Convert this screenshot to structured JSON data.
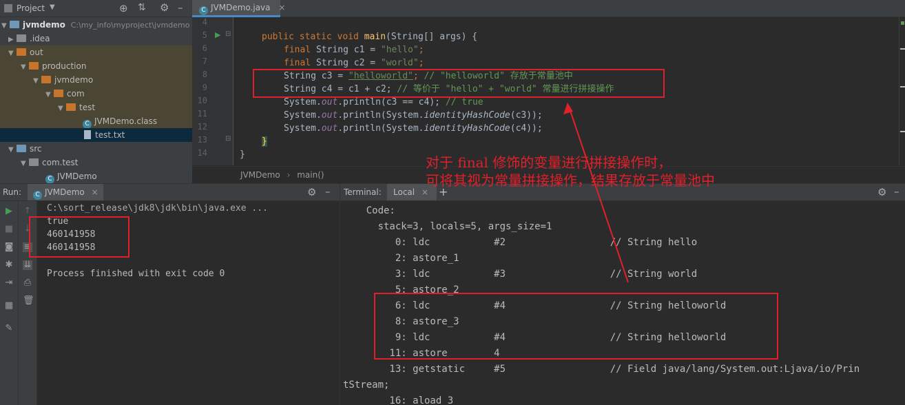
{
  "project_panel": {
    "title": "Project",
    "tree": [
      {
        "label": "jvmdemo",
        "path": "C:\\my_info\\myproject\\jvmdemo",
        "level": 0,
        "expanded": true,
        "icon": "module-folder-icon"
      },
      {
        "label": ".idea",
        "level": 1,
        "expanded": false,
        "icon": "folder-icon"
      },
      {
        "label": "out",
        "level": 1,
        "expanded": true,
        "icon": "folder-icon"
      },
      {
        "label": "production",
        "level": 2,
        "expanded": true,
        "icon": "folder-icon"
      },
      {
        "label": "jvmdemo",
        "level": 3,
        "expanded": true,
        "icon": "folder-icon"
      },
      {
        "label": "com",
        "level": 4,
        "expanded": true,
        "icon": "folder-icon"
      },
      {
        "label": "test",
        "level": 5,
        "expanded": true,
        "icon": "folder-icon"
      },
      {
        "label": "JVMDemo.class",
        "level": 6,
        "icon": "class-file-icon"
      },
      {
        "label": "test.txt",
        "level": 6,
        "icon": "text-file-icon"
      },
      {
        "label": "src",
        "level": 1,
        "expanded": true,
        "icon": "source-folder-icon"
      },
      {
        "label": "com.test",
        "level": 2,
        "expanded": true,
        "icon": "package-icon"
      },
      {
        "label": "JVMDemo",
        "level": 3,
        "icon": "java-class-icon"
      }
    ]
  },
  "editor": {
    "tab_label": "JVMDemo.java",
    "line_numbers": [
      "4",
      "5",
      "6",
      "7",
      "8",
      "9",
      "10",
      "11",
      "12",
      "13",
      "14"
    ],
    "code": {
      "l5_a": "public static void ",
      "l5_fn": "main",
      "l5_b": "(String[] args) {",
      "l6_kw": "final ",
      "l6_a": "String c1 = ",
      "l6_str": "\"hello\"",
      "l6_end": ";",
      "l7_kw": "final ",
      "l7_a": "String c2 = ",
      "l7_str": "\"world\"",
      "l7_end": ";",
      "l8_a": "String c3 = ",
      "l8_str": "\"helloworld\"",
      "l8_end": "; ",
      "l8_cm": "// \"helloworld\" 存放于常量池中",
      "l9_a": "String c4 = c1 + c2; ",
      "l9_cm": "// 等价于 \"hello\" + \"world\" 常量进行拼接操作",
      "l10_a": "System.",
      "l10_out": "out",
      "l10_b": ".println(c3 == c4); ",
      "l10_cm": "// true",
      "l11_a": "System.",
      "l11_out": "out",
      "l11_b": ".println(System.",
      "l11_m": "identityHashCode",
      "l11_c": "(c3));",
      "l12_a": "System.",
      "l12_out": "out",
      "l12_b": ".println(System.",
      "l12_m": "identityHashCode",
      "l12_c": "(c4));",
      "l13": "}",
      "l14": "}"
    },
    "breadcrumb": [
      "JVMDemo",
      "main()"
    ]
  },
  "run_panel": {
    "label": "Run:",
    "tab_label": "JVMDemo",
    "output": [
      "C:\\sort_release\\jdk8\\jdk\\bin\\java.exe ...",
      "true",
      "460141958",
      "460141958",
      "",
      "Process finished with exit code 0"
    ]
  },
  "terminal": {
    "label": "Terminal:",
    "tab_label": "Local",
    "lines": [
      "    Code:",
      "      stack=3, locals=5, args_size=1",
      "         0: ldc           #2                  // String hello",
      "         2: astore_1",
      "         3: ldc           #3                  // String world",
      "         5: astore_2",
      "         6: ldc           #4                  // String helloworld",
      "         8: astore_3",
      "         9: ldc           #4                  // String helloworld",
      "        11: astore        4",
      "        13: getstatic     #5                  // Field java/lang/System.out:Ljava/io/Prin",
      "tStream;",
      "        16: aload_3"
    ]
  },
  "annotation": {
    "line1": "对于 final 修饰的变量进行拼接操作时，",
    "line2": "可将其视为常量拼接操作，结果存放于常量池中",
    "color": "#e0202a"
  }
}
